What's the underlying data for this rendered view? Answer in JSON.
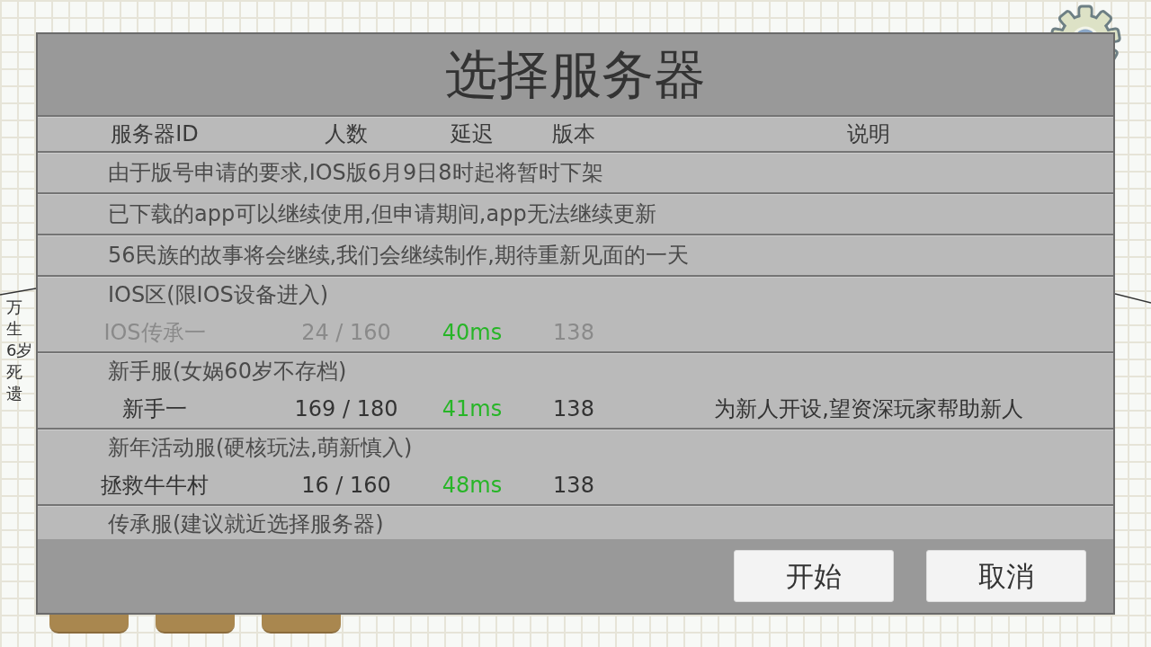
{
  "background": {
    "side_labels": [
      "万",
      "生",
      "6岁",
      "死",
      "遗"
    ]
  },
  "dialog": {
    "title": "选择服务器",
    "columns": [
      "服务器ID",
      "人数",
      "延迟",
      "版本",
      "说明"
    ],
    "notices": [
      "由于版号申请的要求,IOS版6月9日8时起将暂时下架",
      "已下载的app可以继续使用,但申请期间,app无法继续更新",
      "56民族的故事将会继续,我们会继续制作,期待重新见面的一天"
    ],
    "groups": [
      {
        "name": "IOS区(限IOS设备进入)",
        "servers": [
          {
            "name": "IOS传承一",
            "players": "24 / 160",
            "ping": "40ms",
            "version": "138",
            "disabled": true
          }
        ]
      },
      {
        "name": "新手服(女娲60岁不存档)",
        "servers": [
          {
            "name": "新手一",
            "players": "169 / 180",
            "ping": "41ms",
            "version": "138",
            "description": "为新人开设,望资深玩家帮助新人",
            "disabled": false
          }
        ]
      },
      {
        "name": "新年活动服(硬核玩法,萌新慎入)",
        "servers": [
          {
            "name": "拯救牛牛村",
            "players": "16 / 160",
            "ping": "48ms",
            "version": "138",
            "disabled": false
          }
        ]
      },
      {
        "name": "传承服(建议就近选择服务器)"
      }
    ],
    "buttons": [
      "开始",
      "取消"
    ]
  }
}
